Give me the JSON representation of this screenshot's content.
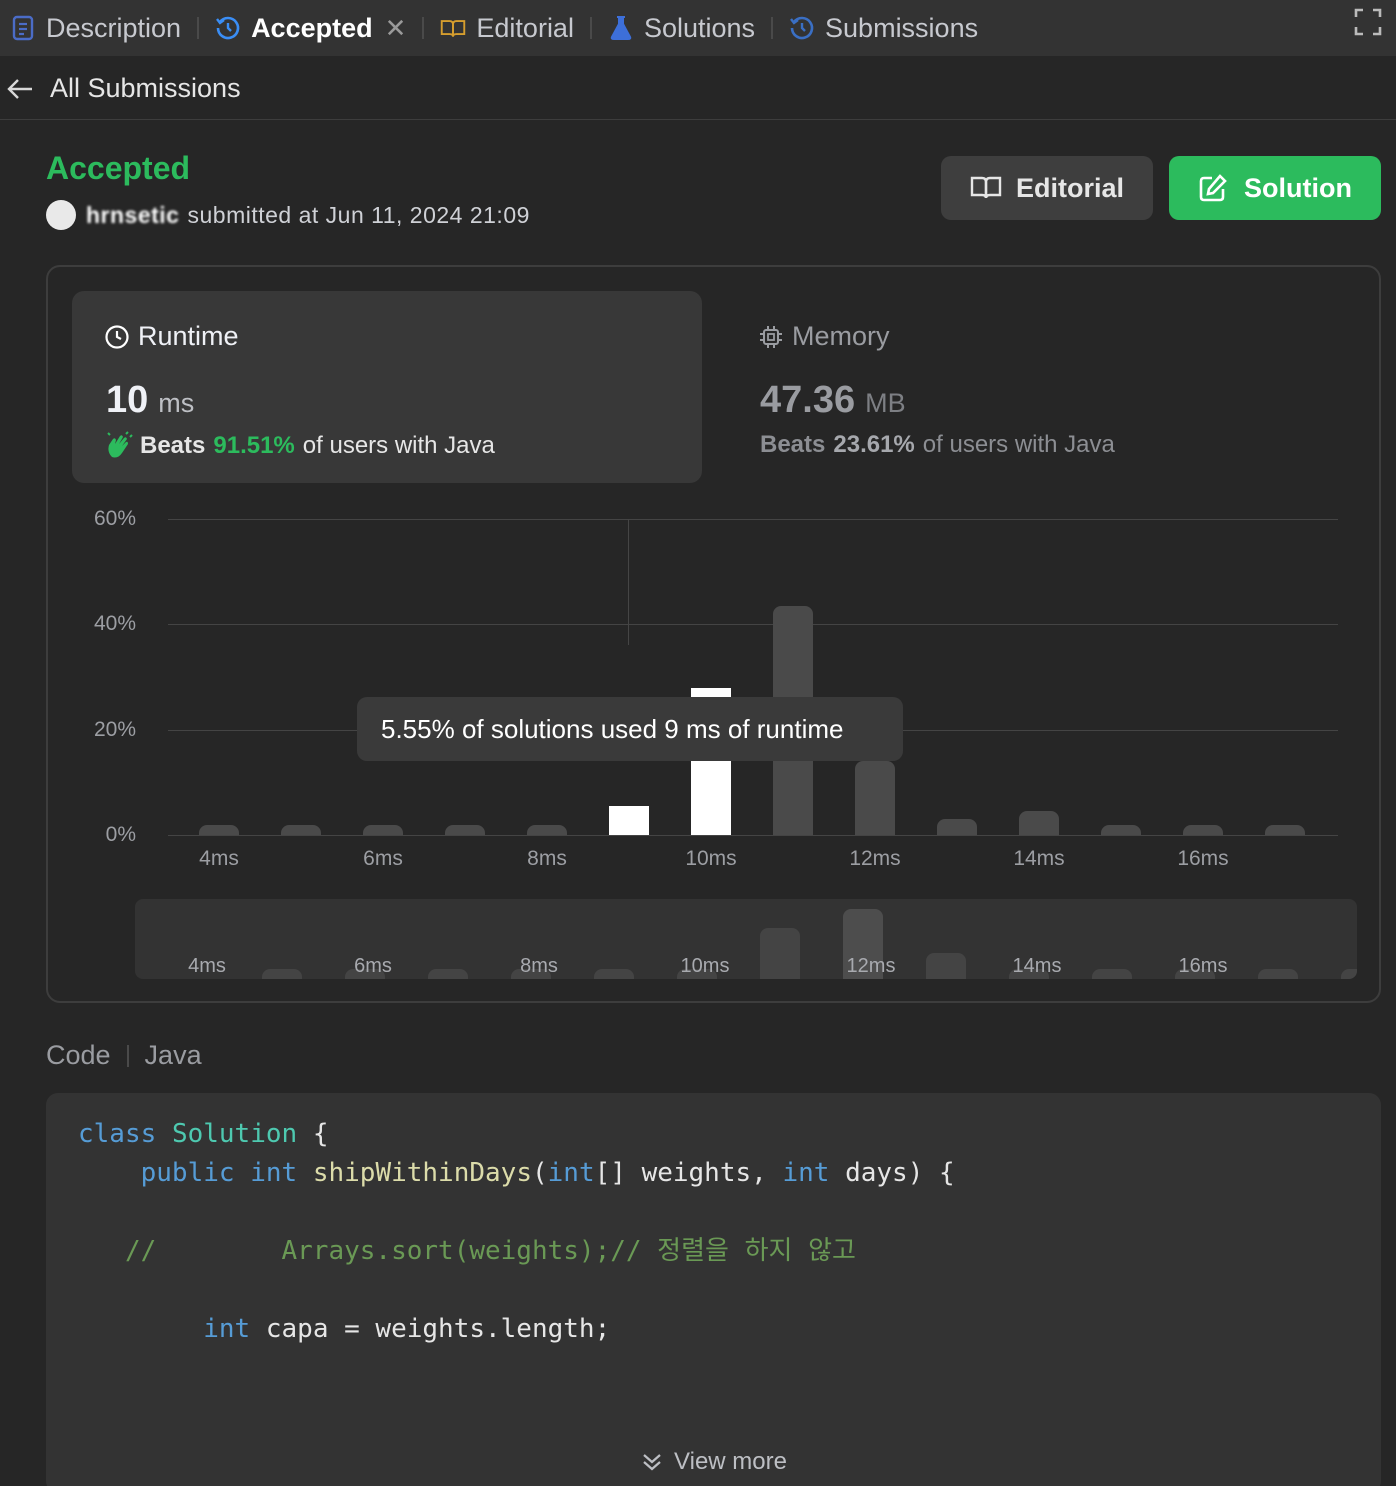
{
  "tabs": [
    {
      "label": "Description",
      "icon": "description-icon"
    },
    {
      "label": "Accepted",
      "icon": "history-icon",
      "active": true
    },
    {
      "label": "Editorial",
      "icon": "book-icon"
    },
    {
      "label": "Solutions",
      "icon": "flask-icon"
    },
    {
      "label": "Submissions",
      "icon": "history-icon"
    }
  ],
  "header": {
    "back_label": "All Submissions"
  },
  "result": {
    "status": "Accepted",
    "username": "hrnsetic",
    "submitted_text": "submitted at Jun 11, 2024 21:09"
  },
  "actions": {
    "editorial_label": "Editorial",
    "solution_label": "Solution"
  },
  "runtime": {
    "title": "Runtime",
    "value": "10",
    "unit": "ms",
    "beats_prefix": "Beats",
    "beats_pct": "91.51%",
    "beats_suffix": "of users with Java"
  },
  "memory": {
    "title": "Memory",
    "value": "47.36",
    "unit": "MB",
    "beats_prefix": "Beats",
    "beats_pct": "23.61%",
    "beats_suffix": "of users with Java"
  },
  "chart_data": {
    "type": "bar",
    "yticks": [
      "60%",
      "40%",
      "20%",
      "0%"
    ],
    "ylim": [
      0,
      60
    ],
    "xtick_labels": [
      "4ms",
      "6ms",
      "8ms",
      "10ms",
      "12ms",
      "14ms",
      "16ms"
    ],
    "values": [
      1.5,
      1.5,
      1.5,
      1.5,
      1.5,
      5.55,
      28,
      43.5,
      14,
      3,
      4.5,
      1.5,
      1.5,
      1.5
    ],
    "tooltip": "5.55% of solutions used 9 ms of runtime"
  },
  "code": {
    "header_label": "Code",
    "language": "Java",
    "view_more": "View more"
  },
  "colors": {
    "accent": "#2cbb5d",
    "background": "#262626"
  }
}
